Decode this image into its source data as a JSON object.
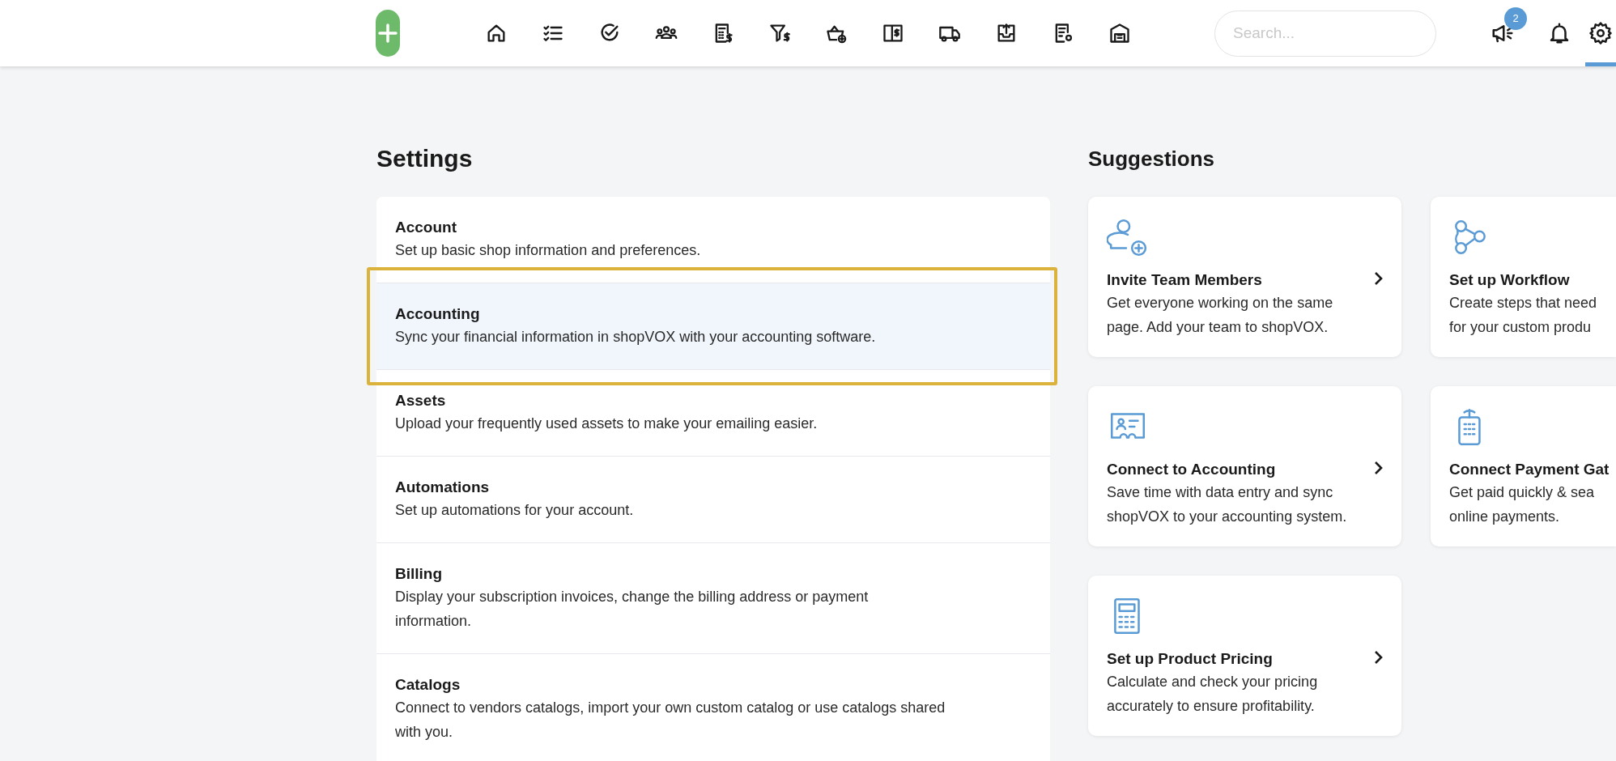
{
  "top_bar": {
    "nav_items": [
      {
        "selected": false
      },
      {
        "selected": false
      },
      {
        "selected": false
      },
      {
        "selected": false
      },
      {
        "selected": false
      },
      {
        "selected": false
      },
      {
        "selected": false
      },
      {
        "selected": false
      },
      {
        "selected": false
      },
      {
        "selected": false
      },
      {
        "selected": false
      },
      {
        "selected": false
      }
    ],
    "search": {
      "placeholder": "Search..."
    },
    "announcements_badge": "2",
    "notifications": {
      "selected": false
    },
    "settings": {
      "selected": true
    }
  },
  "settings": {
    "title": "Settings",
    "items": [
      {
        "title": "Account",
        "description": [
          "Set up basic shop information and preferences."
        ],
        "highlighted": false
      },
      {
        "title": "Accounting",
        "description": [
          "Sync your financial information in shopVOX with your accounting software."
        ],
        "highlighted": true
      },
      {
        "title": "Assets",
        "description": [
          "Upload your frequently used assets to make your emailing easier."
        ],
        "highlighted": false
      },
      {
        "title": "Automations",
        "description": [
          "Set up automations for your account."
        ],
        "highlighted": false
      },
      {
        "title": "Billing",
        "description": [
          "Display your subscription invoices, change the billing address or payment",
          "information."
        ],
        "highlighted": false
      },
      {
        "title": "Catalogs",
        "description": [
          "Connect to vendors catalogs, import your own custom catalog or use catalogs shared",
          "with you."
        ],
        "highlighted": false
      }
    ]
  },
  "suggestions": {
    "title": "Suggestions",
    "cards": [
      {
        "kind": "team",
        "title": "Invite Team Members",
        "description": [
          "Get everyone working on the same",
          "page. Add your team to shopVOX."
        ],
        "arrow": true
      },
      {
        "kind": "workflow",
        "title": "Set up Workflow",
        "description": [
          "Create steps that need",
          "for your custom produ"
        ],
        "arrow": false
      },
      {
        "kind": "accounting",
        "title": "Connect to Accounting",
        "description": [
          "Save time with data entry and sync",
          "shopVOX to your accounting system."
        ],
        "arrow": true
      },
      {
        "kind": "payment",
        "title": "Connect Payment Gat",
        "description": [
          "Get paid quickly & sea",
          "online payments."
        ],
        "arrow": false
      },
      {
        "kind": "pricing",
        "title": "Set up Product Pricing",
        "description": [
          "Calculate and check your pricing",
          "accurately to ensure profitability."
        ],
        "arrow": true
      }
    ]
  }
}
